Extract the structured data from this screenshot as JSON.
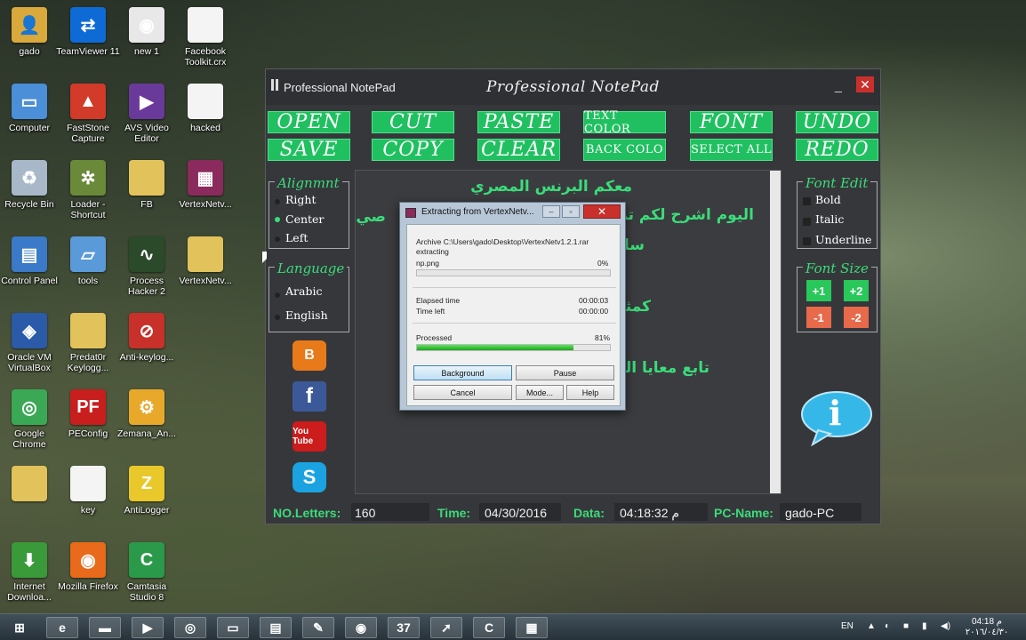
{
  "desktop": {
    "icons": [
      {
        "label": "gado",
        "icon": "user-folder-icon",
        "color": "#d9a93b",
        "glyph": "👤"
      },
      {
        "label": "TeamViewer 11",
        "icon": "teamviewer-icon",
        "color": "#0e6bd6",
        "glyph": "⇄"
      },
      {
        "label": "new 1",
        "icon": "firefox-html-icon",
        "color": "#e8e8e8",
        "glyph": "◉"
      },
      {
        "label": "Facebook Toolkit.crx",
        "icon": "file-icon",
        "color": "#f4f4f4",
        "glyph": ""
      },
      {
        "label": "Computer",
        "icon": "computer-icon",
        "color": "#4a8fd8",
        "glyph": "▭"
      },
      {
        "label": "FastStone Capture",
        "icon": "faststone-icon",
        "color": "#d23a2a",
        "glyph": "▲"
      },
      {
        "label": "AVS Video Editor",
        "icon": "avs-video-icon",
        "color": "#6a3a9a",
        "glyph": "▶"
      },
      {
        "label": "hacked",
        "icon": "file-icon",
        "color": "#f4f4f4",
        "glyph": ""
      },
      {
        "label": "Recycle Bin",
        "icon": "recycle-bin-icon",
        "color": "#a8b8c8",
        "glyph": "♻"
      },
      {
        "label": "Loader - Shortcut",
        "icon": "loader-icon",
        "color": "#6a8a3a",
        "glyph": "✲"
      },
      {
        "label": "FB",
        "icon": "folder-icon",
        "color": "#e2c25a",
        "glyph": ""
      },
      {
        "label": "VertexNetv...",
        "icon": "winrar-icon",
        "color": "#8b2a5c",
        "glyph": "▦"
      },
      {
        "label": "Control Panel",
        "icon": "control-panel-icon",
        "color": "#3a7ac8",
        "glyph": "▤"
      },
      {
        "label": "tools",
        "icon": "tools-icon",
        "color": "#5a9ad8",
        "glyph": "▱"
      },
      {
        "label": "Process Hacker 2",
        "icon": "process-hacker-icon",
        "color": "#2a4a2a",
        "glyph": "∿"
      },
      {
        "label": "VertexNetv...",
        "icon": "folder-icon",
        "color": "#e2c25a",
        "glyph": ""
      },
      {
        "label": "Oracle VM VirtualBox",
        "icon": "virtualbox-icon",
        "color": "#2a5aa8",
        "glyph": "◈"
      },
      {
        "label": "Predat0r Keylogg...",
        "icon": "folder-icon",
        "color": "#e2c25a",
        "glyph": ""
      },
      {
        "label": "Anti-keylog...",
        "icon": "anti-keylogger-icon",
        "color": "#c8302a",
        "glyph": "⊘"
      },
      {
        "label": "",
        "icon": "blank-icon",
        "color": "transparent",
        "glyph": ""
      },
      {
        "label": "Google Chrome",
        "icon": "chrome-icon",
        "color": "#3aa855",
        "glyph": "◎"
      },
      {
        "label": "PEConfig",
        "icon": "peconfig-icon",
        "color": "#c81e1e",
        "glyph": "PF"
      },
      {
        "label": "Zemana_An...",
        "icon": "zemana-icon",
        "color": "#e8a82a",
        "glyph": "⚙"
      },
      {
        "label": "",
        "icon": "blank-icon",
        "color": "transparent",
        "glyph": ""
      },
      {
        "label": "",
        "icon": "folder-icon",
        "color": "#e2c25a",
        "glyph": ""
      },
      {
        "label": "key",
        "icon": "file-icon",
        "color": "#f4f4f4",
        "glyph": ""
      },
      {
        "label": "AntiLogger",
        "icon": "antilogger-icon",
        "color": "#e8c82a",
        "glyph": "Z"
      },
      {
        "label": "",
        "icon": "blank-icon",
        "color": "transparent",
        "glyph": ""
      },
      {
        "label": "Internet Downloa...",
        "icon": "idm-icon",
        "color": "#3a9a3a",
        "glyph": "⬇"
      },
      {
        "label": "Mozilla Firefox",
        "icon": "firefox-icon",
        "color": "#e86a1a",
        "glyph": "◉"
      },
      {
        "label": "Camtasia Studio 8",
        "icon": "camtasia-icon",
        "color": "#2a9a4a",
        "glyph": "C"
      }
    ]
  },
  "notepad": {
    "title": "Professional NotePad",
    "center_title": "Professional NotePad",
    "min": "_",
    "close": "✕",
    "buttons": {
      "open": "OPEN",
      "cut": "CUT",
      "paste": "PASTE",
      "text_color": "TEXT COLOR",
      "font": "FONT",
      "undo": "UNDO",
      "save": "SAVE",
      "copy": "COPY",
      "clear": "CLEAR",
      "back_color": "BACK COLO",
      "select_all": "SELECT ALL",
      "redo": "REDO"
    },
    "alignment": {
      "title": "Alignmnt",
      "right": "Right",
      "center": "Center",
      "left": "Left",
      "selected": "Center"
    },
    "language": {
      "title": "Language",
      "arabic": "Arabic",
      "english": "English"
    },
    "font_edit": {
      "title": "Font Edit",
      "bold": "Bold",
      "italic": "Italic",
      "underline": "Underline"
    },
    "font_size": {
      "title": "Font Size",
      "plus1": "+1",
      "plus2": "+2",
      "minus1": "-1",
      "minus2": "-2"
    },
    "social": {
      "blogger": "B",
      "facebook": "f",
      "youtube": "You Tube",
      "skype": "S"
    },
    "editor_lines": [
      "معكم البرنس المصري",
      "اليوم اشرح لكم تر",
      "صي",
      "سان",
      "كمثا",
      "تابع معايا الن"
    ],
    "info_glyph": "i",
    "status": {
      "letters_label": "NO.Letters:",
      "letters_value": "160",
      "time_label": "Time:",
      "time_value": "04/30/2016",
      "data_label": "Data:",
      "data_value": "04:18:32 م",
      "pc_label": "PC-Name:",
      "pc_value": "gado-PC"
    }
  },
  "rar": {
    "title": "Extracting from VertexNetv...",
    "archive": "Archive C:\\Users\\gado\\Desktop\\VertexNetv1.2.1.rar",
    "action": "extracting",
    "file": "np.png",
    "file_percent": "0%",
    "file_progress": 0,
    "elapsed_label": "Elapsed time",
    "elapsed_value": "00:00:03",
    "left_label": "Time left",
    "left_value": "00:00:00",
    "processed_label": "Processed",
    "processed_percent": "81%",
    "processed_progress": 0.81,
    "btn_background": "Background",
    "btn_pause": "Pause",
    "btn_cancel": "Cancel",
    "btn_mode": "Mode...",
    "btn_help": "Help"
  },
  "taskbar": {
    "items": [
      {
        "icon": "start-icon",
        "glyph": "⊞"
      },
      {
        "icon": "ie-icon",
        "glyph": "e"
      },
      {
        "icon": "explorer-icon",
        "glyph": "▬"
      },
      {
        "icon": "media-player-icon",
        "glyph": "▶"
      },
      {
        "icon": "chrome-icon",
        "glyph": "◎"
      },
      {
        "icon": "app-icon",
        "glyph": "▭"
      },
      {
        "icon": "notepad-icon",
        "glyph": "▤"
      },
      {
        "icon": "tool-icon",
        "glyph": "✎"
      },
      {
        "icon": "firefox-icon",
        "glyph": "◉"
      },
      {
        "icon": "video-icon",
        "glyph": "37"
      },
      {
        "icon": "pointer-icon",
        "glyph": "➚"
      },
      {
        "icon": "camtasia-icon",
        "glyph": "C"
      },
      {
        "icon": "winrar-icon",
        "glyph": "▦"
      }
    ],
    "lang": "EN",
    "clock_time": "04:18 م",
    "clock_date": "٢٠١٦/٠٤/٣٠"
  }
}
